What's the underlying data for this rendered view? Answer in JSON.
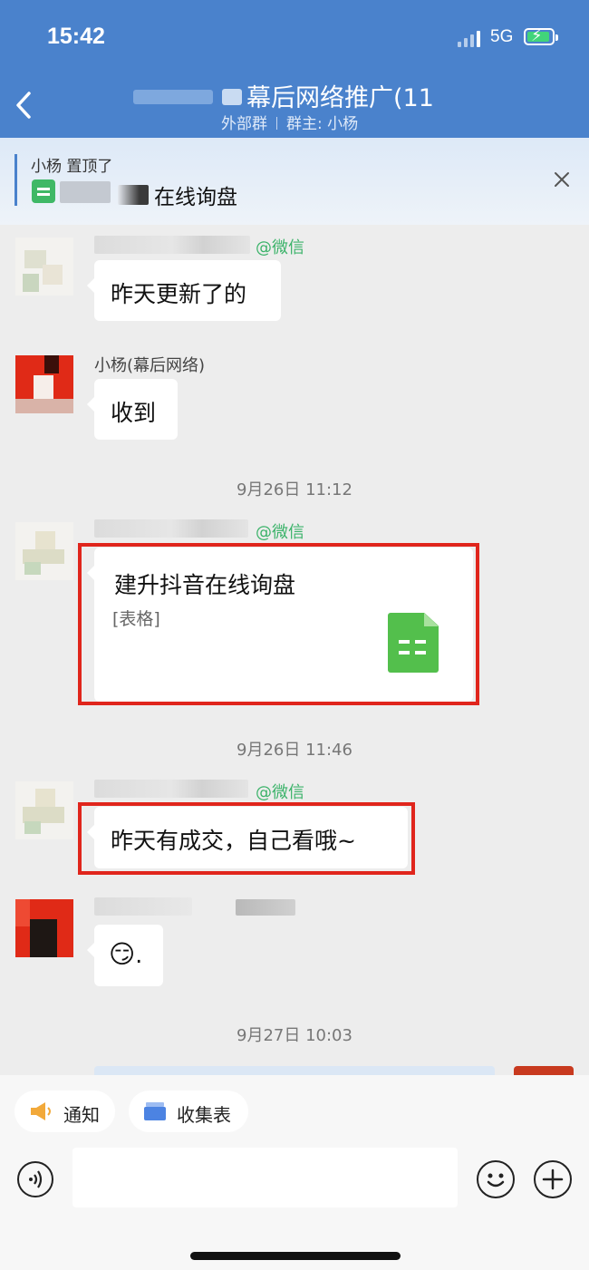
{
  "status_bar": {
    "time": "15:42",
    "network": "5G"
  },
  "header": {
    "title": "幕后网络推广(11",
    "subtitle_group": "外部群",
    "subtitle_owner": "群主: 小杨"
  },
  "pinned": {
    "from": "小杨 置顶了",
    "text": "在线询盘"
  },
  "messages": [
    {
      "tag": "@微信",
      "text": "昨天更新了的"
    },
    {
      "name": "小杨(幕后网络)",
      "text": "收到"
    },
    {
      "timestamp": "9月26日 11:12",
      "tag": "@微信",
      "file_title": "建升抖音在线询盘",
      "file_type": "[表格]"
    },
    {
      "timestamp": "9月26日 11:46",
      "tag": "@微信",
      "text": "昨天有成交，自己看哦~"
    },
    {
      "emoji": "😏",
      "text": "."
    },
    {
      "timestamp": "9月27日 10:03"
    }
  ],
  "toolbar": {
    "notice_label": "通知",
    "form_label": "收集表"
  },
  "colors": {
    "header_blue": "#4a82cc",
    "highlight_red": "#e0251c",
    "wechat_green": "#3cb36a",
    "sheet_green": "#53bf4c"
  }
}
